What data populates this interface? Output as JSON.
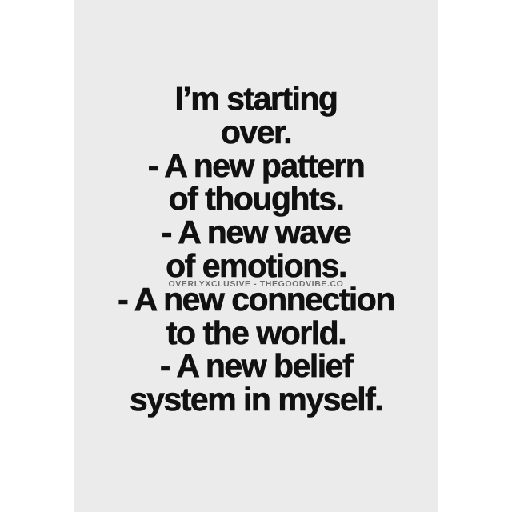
{
  "colors": {
    "background": "#ffffff",
    "card": "#ebebeb",
    "text": "#111111",
    "watermark": "#6e6e6e"
  },
  "quote": {
    "lines": [
      "I’m starting",
      "over.",
      "- A new pattern",
      "of thoughts.",
      "- A new wave",
      "of emotions.",
      "- A new connection",
      "to the world.",
      "- A new belief",
      "system in myself."
    ]
  },
  "watermark": {
    "text": "OVERLYXCLUSIVE - THEGOODVIBE.CO"
  }
}
